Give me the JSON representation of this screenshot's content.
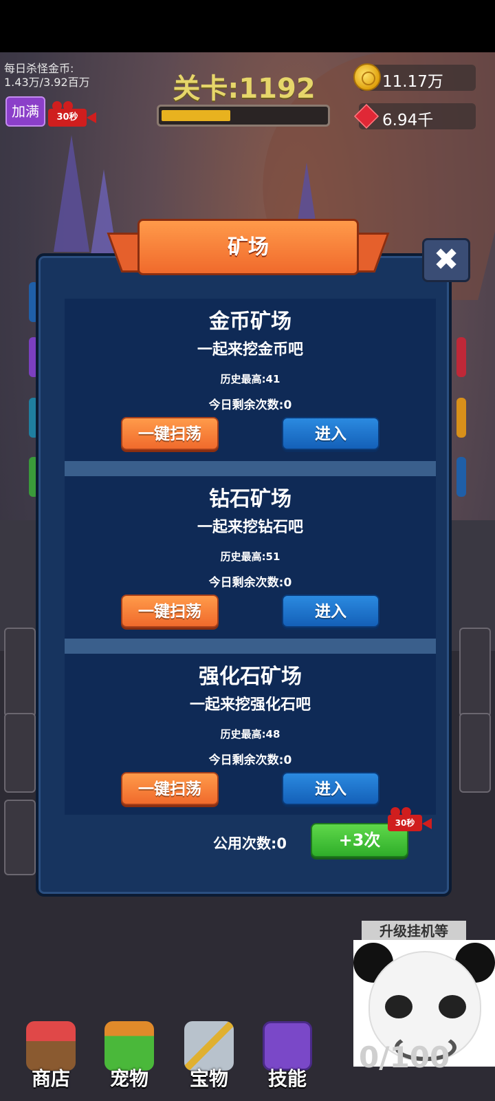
{
  "hud": {
    "kill_gold_label": "每日杀怪金币:",
    "kill_gold_value": "1.43万/3.92百万",
    "fill_button": "加满",
    "video_timer": "30秒",
    "level_label": "关卡:1192",
    "level_progress": 0.42,
    "gold_amount": "11.17万",
    "gem_amount": "6.94千"
  },
  "modal": {
    "title": "矿场",
    "close_symbol": "✖",
    "mines": [
      {
        "name": "金币矿场",
        "desc": "一起来挖金币吧",
        "best": "历史最高:41",
        "remaining": "今日剩余次数:0",
        "sweep": "一键扫荡",
        "enter": "进入"
      },
      {
        "name": "钻石矿场",
        "desc": "一起来挖钻石吧",
        "best": "历史最高:51",
        "remaining": "今日剩余次数:0",
        "sweep": "一键扫荡",
        "enter": "进入"
      },
      {
        "name": "强化石矿场",
        "desc": "一起来挖强化石吧",
        "best": "历史最高:48",
        "remaining": "今日剩余次数:0",
        "sweep": "一键扫荡",
        "enter": "进入"
      }
    ],
    "shared_count": "公用次数:0",
    "add_button": "+3次",
    "add_video_timer": "30秒"
  },
  "nav": {
    "shop": "商店",
    "pet": "宠物",
    "treasure": "宝物",
    "skill": "技能",
    "counter": "0/100"
  },
  "sticker": {
    "caption": "升级挂机等"
  },
  "colors": {
    "modal_bg": "#17345f",
    "card_bg": "#0f2a56",
    "orange": "#f06a2c",
    "blue": "#1460b8",
    "green": "#2fae2a",
    "level_text": "#e6d66a"
  }
}
